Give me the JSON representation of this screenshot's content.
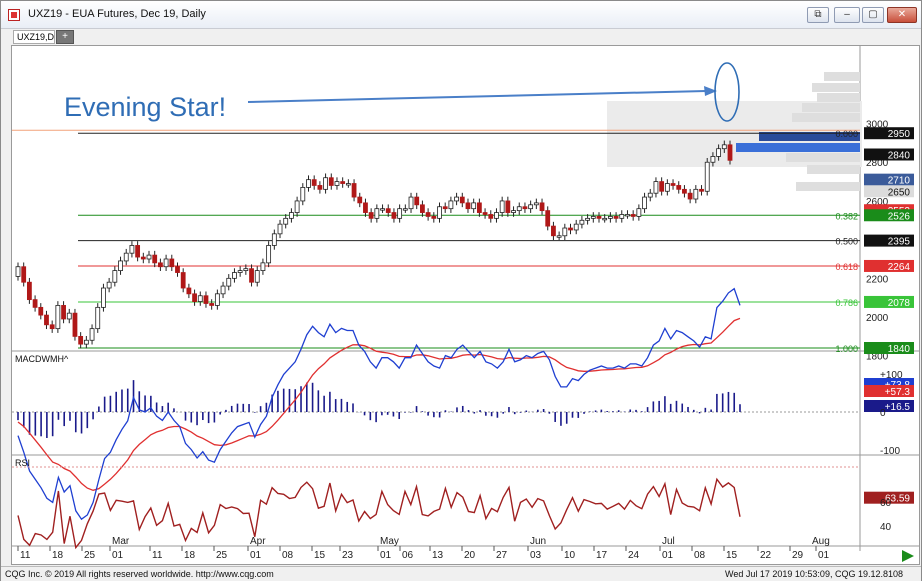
{
  "window": {
    "title": "UXZ19 - EUA Futures, Dec 19, Daily",
    "buttons": [
      "⧉",
      "–",
      "▢",
      "✕"
    ]
  },
  "tabs": {
    "active": "UXZ19,D",
    "add_label": "+"
  },
  "annotation": {
    "text": "Evening Star!"
  },
  "price_panel": {
    "axis_ticks": [
      {
        "label": "3000",
        "value": 3000
      },
      {
        "label": "2800",
        "value": 2800
      },
      {
        "label": "2600",
        "value": 2600
      },
      {
        "label": "2400",
        "value": 2400
      },
      {
        "label": "2200",
        "value": 2200
      },
      {
        "label": "2000",
        "value": 2000
      },
      {
        "label": "1800",
        "value": 1800
      }
    ],
    "badges": [
      {
        "label": "2950",
        "value": 2950,
        "color": "#111111"
      },
      {
        "label": "2840",
        "value": 2840,
        "color": "#111111"
      },
      {
        "label": "2710",
        "value": 2710,
        "color": "#3b5b9a"
      },
      {
        "label": "2650",
        "value": 2650,
        "color": "#dcdcdc"
      },
      {
        "label": "2552",
        "value": 2552,
        "color": "#e03030"
      },
      {
        "label": "2526",
        "value": 2526,
        "color": "#1a8c1a"
      },
      {
        "label": "2395",
        "value": 2395,
        "color": "#111111"
      },
      {
        "label": "2264",
        "value": 2264,
        "color": "#e03030"
      },
      {
        "label": "2078",
        "value": 2078,
        "color": "#39c439"
      },
      {
        "label": "1840",
        "value": 1840,
        "color": "#1a8c1a"
      }
    ],
    "fib_levels": [
      {
        "label": "0.000",
        "value": 2950,
        "color": "#222222"
      },
      {
        "label": "0.382",
        "value": 2526,
        "color": "#1a8c1a"
      },
      {
        "label": "0.500",
        "value": 2395,
        "color": "#222222"
      },
      {
        "label": "0.618",
        "value": 2264,
        "color": "#e03030"
      },
      {
        "label": "0.786",
        "value": 2078,
        "color": "#39c439"
      },
      {
        "label": "1.000",
        "value": 1840,
        "color": "#1a8c1a"
      }
    ]
  },
  "macd_panel": {
    "title": "MACDWMH^",
    "axis_ticks": [
      {
        "label": "+100",
        "value": 100
      },
      {
        "label": "0",
        "value": 0
      },
      {
        "label": "-100",
        "value": -100
      }
    ],
    "badges": [
      {
        "label": "+73.8",
        "value": 73.8,
        "color": "#1f3fd1"
      },
      {
        "label": "+57.3",
        "value": 57.3,
        "color": "#e03030"
      },
      {
        "label": "+16.5",
        "value": 16.5,
        "color": "#1a1a8a"
      }
    ]
  },
  "rsi_panel": {
    "title": "RSI",
    "axis_ticks": [
      {
        "label": "60",
        "value": 60
      },
      {
        "label": "40",
        "value": 40
      }
    ],
    "badges": [
      {
        "label": "63.59",
        "value": 63.59,
        "color": "#a02020"
      }
    ]
  },
  "date_axis": {
    "ticks": [
      "11",
      "18",
      "25",
      "01",
      "11",
      "18",
      "25",
      "01",
      "08",
      "15",
      "23",
      "01",
      "06",
      "13",
      "20",
      "27",
      "03",
      "10",
      "17",
      "24",
      "01",
      "08",
      "15",
      "22",
      "29",
      "01"
    ],
    "months": [
      "Mar",
      "Apr",
      "May",
      "Jun",
      "Jul",
      "Aug"
    ]
  },
  "status_bar": {
    "left": "CQG Inc. © 2019 All rights reserved worldwide. http://www.cqg.com",
    "right": "Wed Jul 17 2019 10:53:09, CQG 19.12.8108"
  },
  "colors": {
    "up_candle": "#1a8c1a",
    "down_candle": "#b01818",
    "macd_line": "#1f3fd1",
    "signal_line": "#e03030",
    "histogram": "#1a1a8a",
    "rsi_line": "#a02020",
    "annotation": "#2f6db5"
  },
  "chart_data": {
    "type": "candlestick",
    "symbol": "UXZ19",
    "closes": [
      2260,
      2180,
      2090,
      2050,
      2010,
      1960,
      1940,
      2060,
      1990,
      2020,
      1900,
      1860,
      1880,
      1940,
      2050,
      2150,
      2180,
      2240,
      2290,
      2330,
      2370,
      2310,
      2300,
      2320,
      2280,
      2260,
      2300,
      2260,
      2230,
      2150,
      2120,
      2080,
      2110,
      2070,
      2060,
      2120,
      2160,
      2200,
      2230,
      2240,
      2250,
      2180,
      2240,
      2280,
      2370,
      2430,
      2480,
      2510,
      2540,
      2600,
      2670,
      2710,
      2680,
      2660,
      2720,
      2680,
      2700,
      2690,
      2690,
      2620,
      2590,
      2540,
      2510,
      2560,
      2560,
      2540,
      2510,
      2560,
      2560,
      2620,
      2580,
      2540,
      2520,
      2510,
      2570,
      2560,
      2600,
      2620,
      2590,
      2560,
      2590,
      2540,
      2530,
      2510,
      2540,
      2600,
      2540,
      2550,
      2570,
      2560,
      2580,
      2590,
      2550,
      2470,
      2420,
      2420,
      2460,
      2450,
      2480,
      2500,
      2510,
      2520,
      2510,
      2510,
      2520,
      2510,
      2530,
      2530,
      2520,
      2560,
      2620,
      2640,
      2700,
      2650,
      2690,
      2680,
      2660,
      2640,
      2610,
      2660,
      2650,
      2800,
      2830,
      2870,
      2890,
      2810
    ]
  }
}
